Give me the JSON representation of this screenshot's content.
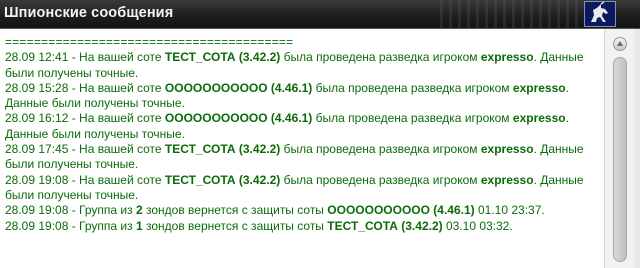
{
  "window": {
    "title": "Шпионские сообщения",
    "icon": "unicorn-icon"
  },
  "log": {
    "divider": "========================================",
    "messages": [
      {
        "pre": "28.09 12:41 - На вашей соте ",
        "cell": "ТЕСТ_СОТА (3.42.2)",
        "mid": " была проведена разведка игроком ",
        "player": "expresso",
        "post": ". Данные были получены точные."
      },
      {
        "pre": "28.09 15:28 - На вашей соте ",
        "cell": "ООООООООООО (4.46.1)",
        "mid": " была проведена разведка игроком ",
        "player": "expresso",
        "post": ". Данные были получены точные."
      },
      {
        "pre": "28.09 16:12 - На вашей соте ",
        "cell": "ООООООООООО (4.46.1)",
        "mid": " была проведена разведка игроком ",
        "player": "expresso",
        "post": ". Данные были получены точные."
      },
      {
        "pre": "28.09 17:45 - На вашей соте ",
        "cell": "ТЕСТ_СОТА (3.42.2)",
        "mid": " была проведена разведка игроком ",
        "player": "expresso",
        "post": ". Данные были получены точные."
      },
      {
        "pre": "28.09 19:08 - На вашей соте ",
        "cell": "ТЕСТ_СОТА (3.42.2)",
        "mid": " была проведена разведка игроком ",
        "player": "expresso",
        "post": ". Данные были получены точные."
      }
    ],
    "returns": [
      {
        "pre": "28.09 19:08 - Группа из ",
        "count": "2",
        "mid": " зондов вернется с защиты соты ",
        "cell": "ООООООООООО (4.46.1)",
        "post": " 01.10 23:37."
      },
      {
        "pre": "28.09 19:08 - Группа из ",
        "count": "1",
        "mid": " зондов вернется с защиты соты ",
        "cell": "ТЕСТ_СОТА (3.42.2)",
        "post": " 03.10 03:32."
      }
    ]
  },
  "scrollbar": {
    "up_icon": "scroll-up-arrow-icon"
  },
  "colors": {
    "text_green": "#0a6b0a",
    "titlebar": "#1e1e1e",
    "icon_bg": "#0b1a5c"
  }
}
